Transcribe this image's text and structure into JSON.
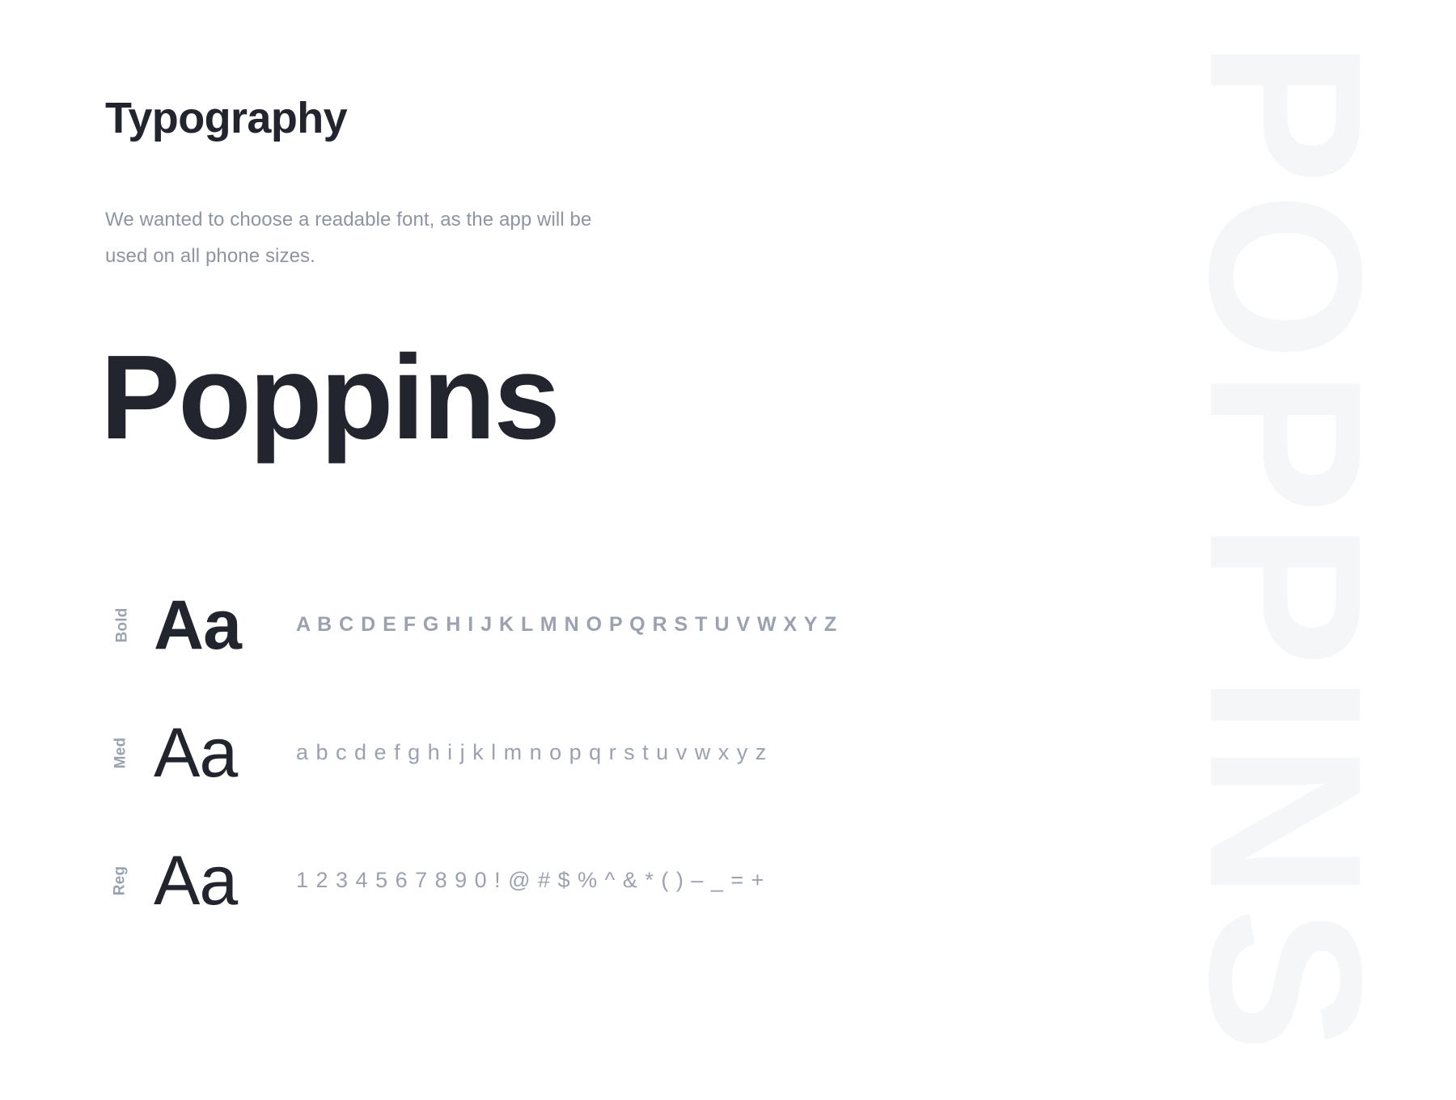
{
  "page": {
    "title": "Typography",
    "intro_line_1": "We wanted to choose a readable font, as the app will be",
    "intro_line_2": "used on all phone sizes.",
    "font_name": "Poppins",
    "watermark": "POPPINS"
  },
  "colors": {
    "heading": "#22252e",
    "muted": "#8d94a3",
    "glyph": "#9aa1b0",
    "watermark": "#f5f6f7",
    "background": "#ffffff"
  },
  "specimens": [
    {
      "weight_label": "Bold",
      "sample": "Aa",
      "glyphs": "A B C D E F G H I J K L M N O P Q R S T U V W X Y Z"
    },
    {
      "weight_label": "Med",
      "sample": "Aa",
      "glyphs": "a b c d e f g h i j k l m n o p q r s t u v w x y z"
    },
    {
      "weight_label": "Reg",
      "sample": "Aa",
      "glyphs": "1 2 3 4 5 6 7 8 9 0 ! @ # $ % ^ & * ( ) – _ = +"
    }
  ]
}
